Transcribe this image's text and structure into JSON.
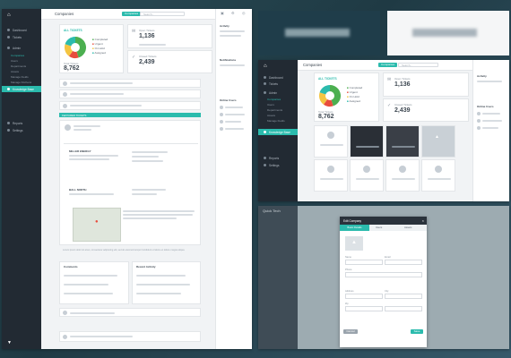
{
  "app": {
    "name": "Quick Tech",
    "page_title": "Companies"
  },
  "topbar": {
    "tab_label": "Companies",
    "search_placeholder": "Search..."
  },
  "sidebar": {
    "items": [
      {
        "label": "Dashboard"
      },
      {
        "label": "Tickets"
      },
      {
        "label": "Admin"
      },
      {
        "label": "Companies"
      },
      {
        "label": "Users"
      },
      {
        "label": "Departments"
      },
      {
        "label": "Assets"
      },
      {
        "label": "Manage Fields"
      },
      {
        "label": "Manage Kitchens"
      },
      {
        "label": "Knowledge Base"
      },
      {
        "label": "Reports"
      },
      {
        "label": "Settings"
      }
    ]
  },
  "stats": {
    "all_tickets_label": "ALL TICKETS",
    "total": "8,762",
    "total_label": "Total Tickets",
    "open_value": "1,136",
    "open_label": "Open Tickets",
    "closed_value": "2,439",
    "closed_label": "Closed Tickets",
    "legend": [
      "Completed",
      "Urgent",
      "On Hold",
      "Assigned"
    ]
  },
  "pie_colors": [
    "#4caf50",
    "#e84c3d",
    "#f4c542",
    "#2bbbad"
  ],
  "feed": {
    "section_label": "FEATURED TICKETS",
    "company_title": "MILLER ENERGY",
    "company_title_2": "BALL NORTH",
    "comments_label": "Comments",
    "recent_label": "Recent Activity",
    "note": "Lorem ipsum dolor sit amet, consectetur adipiscing elit, sed do eiusmod tempor incididunt ut labore et dolore magna aliqua."
  },
  "right_panel": {
    "heading_1": "Activity",
    "heading_2": "Notifications",
    "heading_3": "Online Users"
  },
  "modal": {
    "title": "Edit Company",
    "tabs": [
      "Basic Details",
      "Users",
      "Assets"
    ],
    "field_labels": [
      "Name",
      "Email",
      "Phone",
      "Address",
      "City",
      "Zip"
    ],
    "cancel": "Cancel",
    "save": "Save"
  }
}
